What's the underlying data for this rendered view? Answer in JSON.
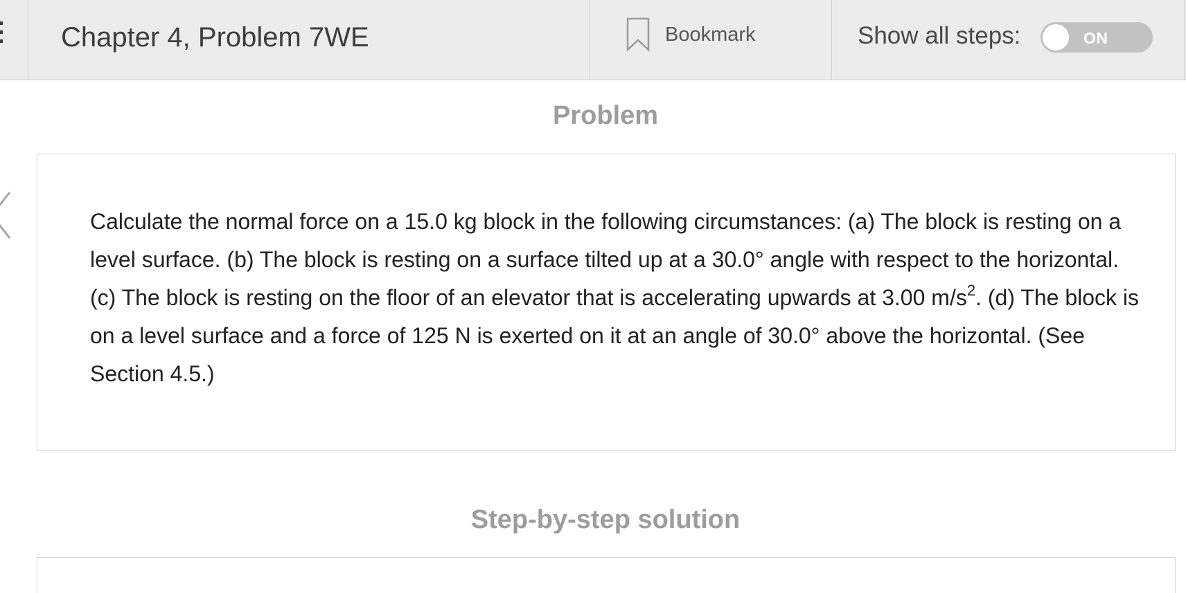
{
  "header": {
    "title": "Chapter 4, Problem 7WE",
    "bookmark_label": "Bookmark",
    "show_steps_label": "Show all steps:",
    "toggle_label": "ON"
  },
  "problem": {
    "heading": "Problem",
    "text_before_sup": "Calculate the normal force on a 15.0 kg block in the following circumstances: (a) The block is resting on  a level surface. (b) The block is resting on a surface tilted up at a 30.0° angle with respect to the horizontal. (c) The block is resting on the floor of an elevator that is accelerating upwards at 3.00 m/s",
    "sup": "2",
    "text_after_sup": ". (d) The block is on a level surface and a force of 125 N is exerted on it at an angle of 30.0° above the horizontal. (See Section 4.5.)"
  },
  "solution": {
    "heading": "Step-by-step solution"
  },
  "icons": {
    "menu": "menu-icon",
    "bookmark": "bookmark-icon",
    "previous": "chevron-left-icon"
  }
}
